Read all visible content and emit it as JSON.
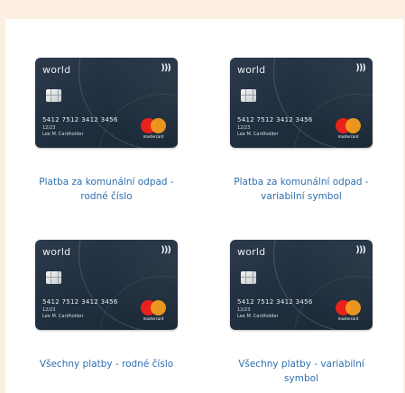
{
  "tiles": [
    {
      "label": "Platba za komunální odpad - rodné číslo",
      "card": {
        "brand": "world",
        "contactless_symbol": ")))",
        "number": "5412 7512 3412 3456",
        "valid": "12/23",
        "holder": "Lee M. Cardholder",
        "network": "mastercard"
      }
    },
    {
      "label": "Platba za komunální odpad - variabilní symbol",
      "card": {
        "brand": "world",
        "contactless_symbol": ")))",
        "number": "5412 7512 3412 3456",
        "valid": "12/23",
        "holder": "Lee M. Cardholder",
        "network": "mastercard"
      }
    },
    {
      "label": "Všechny platby - rodné číslo",
      "card": {
        "brand": "world",
        "contactless_symbol": ")))",
        "number": "5412 7512 3412 3456",
        "valid": "12/23",
        "holder": "Lee M. Cardholder",
        "network": "mastercard"
      }
    },
    {
      "label": "Všechny platby - variabilní symbol",
      "card": {
        "brand": "world",
        "contactless_symbol": ")))",
        "number": "5412 7512 3412 3456",
        "valid": "12/23",
        "holder": "Lee M. Cardholder",
        "network": "mastercard"
      }
    }
  ],
  "colors": {
    "page_background": "#fdeee2",
    "panel_background": "#ffffff",
    "link": "#2e6fae",
    "card_background": "#203040",
    "mastercard_red": "#e8221b",
    "mastercard_orange": "#f89e1b"
  },
  "icons": {
    "contactless": "contactless-icon",
    "chip": "chip-icon",
    "network_logo": "mastercard-logo-icon"
  }
}
